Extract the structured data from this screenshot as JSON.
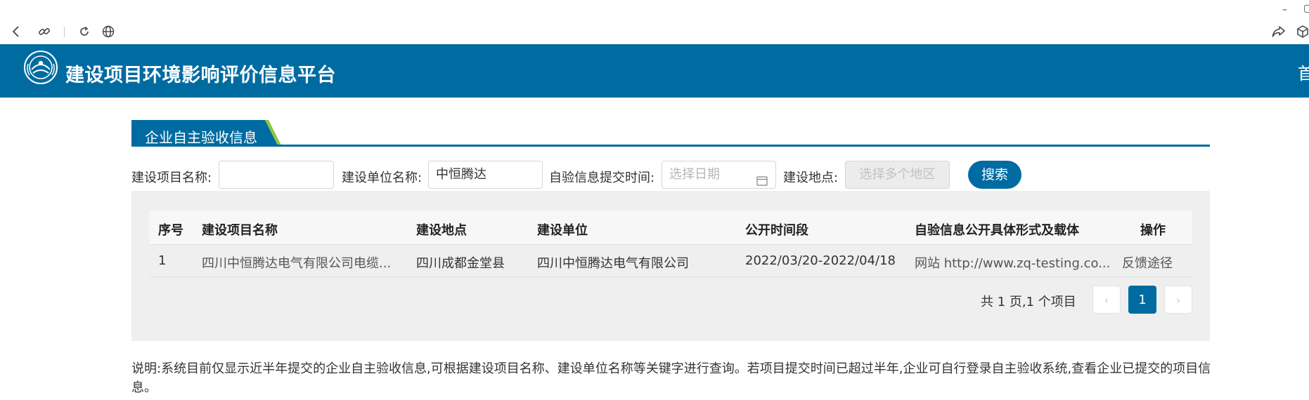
{
  "header": {
    "title": "建设项目环境影响评价信息平台",
    "nav_first": "首"
  },
  "section": {
    "title": "企业自主验收信息"
  },
  "search": {
    "project_label": "建设项目名称:",
    "project_value": "",
    "unit_label": "建设单位名称:",
    "unit_value": "中恒腾达",
    "time_label": "自验信息提交时间:",
    "time_placeholder": "选择日期",
    "location_label": "建设地点:",
    "location_placeholder": "选择多个地区",
    "search_button": "搜索"
  },
  "table": {
    "headers": [
      "序号",
      "建设项目名称",
      "建设地点",
      "建设单位",
      "公开时间段",
      "自验信息公开具体形式及载体",
      "操作"
    ],
    "rows": [
      [
        "1",
        "四川中恒腾达电气有限公司电缆...",
        "四川成都金堂县",
        "四川中恒腾达电气有限公司",
        "2022/03/20-2022/04/18",
        "网站 http://www.zq-testing.co...",
        "反馈途径"
      ]
    ]
  },
  "pagination": {
    "info": "共 1 页,1 个项目",
    "current_page": "1",
    "prev": "‹",
    "next": "›"
  },
  "note": "说明:系统目前仅显示近半年提交的企业自主验收信息,可根据建设项目名称、建设单位名称等关键字进行查询。若项目提交时间已超过半年,企业可自行登录自主验收系统,查看企业已提交的项目信息。",
  "colors": {
    "primary": "#006ba1",
    "tab_stripe_green": "#8cc63f",
    "panel_bg": "#efefef"
  }
}
